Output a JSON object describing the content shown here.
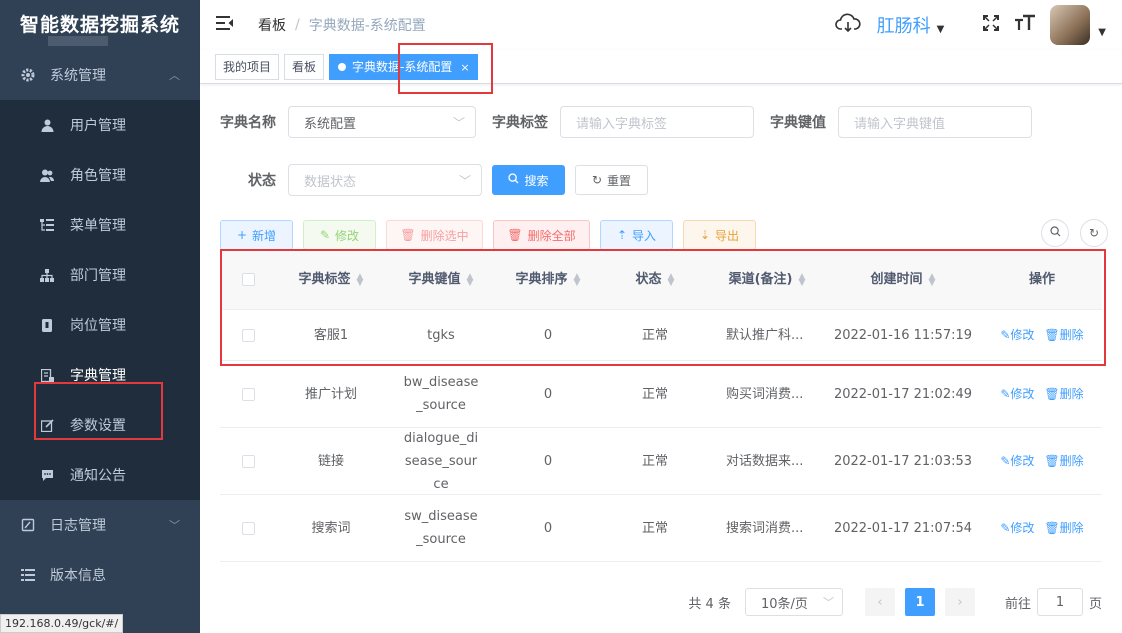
{
  "sidebar": {
    "app_title": "智能数据挖掘系统",
    "group_system": "系统管理",
    "items": [
      {
        "label": "用户管理",
        "icon": "user-icon"
      },
      {
        "label": "角色管理",
        "icon": "peoples-icon"
      },
      {
        "label": "菜单管理",
        "icon": "tree-table-icon"
      },
      {
        "label": "部门管理",
        "icon": "tree-icon"
      },
      {
        "label": "岗位管理",
        "icon": "post-icon"
      },
      {
        "label": "字典管理",
        "icon": "dict-icon"
      },
      {
        "label": "参数设置",
        "icon": "edit-icon"
      },
      {
        "label": "通知公告",
        "icon": "message-icon"
      }
    ],
    "group_log": "日志管理",
    "group_version": "版本信息"
  },
  "status_url": "192.168.0.49/gck/#/",
  "navbar": {
    "breadcrumb": [
      "看板",
      "字典数据-系统配置"
    ],
    "department": "肛肠科"
  },
  "tags": {
    "items": [
      "我的项目",
      "看板"
    ],
    "active": "字典数据-系统配置"
  },
  "search": {
    "dict_name_label": "字典名称",
    "dict_name_value": "系统配置",
    "dict_label_label": "字典标签",
    "dict_label_placeholder": "请输入字典标签",
    "dict_value_label": "字典键值",
    "dict_value_placeholder": "请输入字典键值",
    "status_label": "状态",
    "status_placeholder": "数据状态",
    "search_btn": "搜索",
    "reset_btn": "重置"
  },
  "toolbar": {
    "add": "新增",
    "edit": "修改",
    "delete_selected": "删除选中",
    "delete_all": "删除全部",
    "import": "导入",
    "export": "导出"
  },
  "table": {
    "columns": [
      "字典标签",
      "字典键值",
      "字典排序",
      "状态",
      "渠道(备注)",
      "创建时间",
      "操作"
    ],
    "op_edit": "修改",
    "op_delete": "删除",
    "rows": [
      {
        "label": "客服1",
        "value": "tgks",
        "sort": "0",
        "status": "正常",
        "remark": "默认推广科...",
        "time": "2022-01-16 11:57:19"
      },
      {
        "label": "推广计划",
        "value": "bw_disease_source",
        "sort": "0",
        "status": "正常",
        "remark": "购买词消费...",
        "time": "2022-01-17 21:02:49"
      },
      {
        "label": "链接",
        "value": "dialogue_disease_source",
        "sort": "0",
        "status": "正常",
        "remark": "对话数据来...",
        "time": "2022-01-17 21:03:53"
      },
      {
        "label": "搜索词",
        "value": "sw_disease_source",
        "sort": "0",
        "status": "正常",
        "remark": "搜索词消费...",
        "time": "2022-01-17 21:07:54"
      }
    ]
  },
  "pagination": {
    "total": "共 4 条",
    "page_size": "10条/页",
    "current": "1",
    "goto_prefix": "前往",
    "goto_value": "1",
    "goto_suffix": "页"
  },
  "colors": {
    "primary": "#409eff",
    "sidebar_bg": "#304156",
    "highlight": "#e4393c"
  }
}
